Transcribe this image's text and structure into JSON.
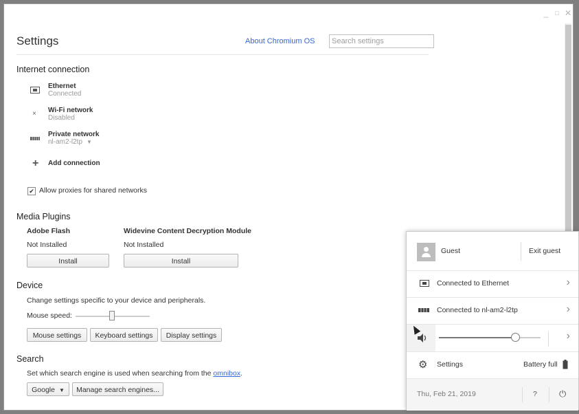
{
  "window": {
    "minimize": "_",
    "maximize": "□",
    "close": "✕"
  },
  "header": {
    "title": "Settings",
    "about_link": "About Chromium OS",
    "search_placeholder": "Search settings"
  },
  "internet": {
    "title": "Internet connection",
    "networks": [
      {
        "name": "Ethernet",
        "status": "Connected",
        "icon": "ethernet-icon"
      },
      {
        "name": "Wi-Fi network",
        "status": "Disabled",
        "icon": "wifi-off-icon"
      },
      {
        "name": "Private network",
        "status": "nl-am2-l2tp",
        "icon": "vpn-icon"
      }
    ],
    "add_connection": "Add connection",
    "proxy_label": "Allow proxies for shared networks",
    "proxy_checked": true
  },
  "media": {
    "title": "Media Plugins",
    "plugins": [
      {
        "name": "Adobe Flash",
        "status": "Not Installed",
        "button": "Install"
      },
      {
        "name": "Widevine Content Decryption Module",
        "status": "Not Installed",
        "button": "Install"
      }
    ]
  },
  "device": {
    "title": "Device",
    "description": "Change settings specific to your device and peripherals.",
    "mouse_speed_label": "Mouse speed:",
    "buttons": [
      "Mouse settings",
      "Keyboard settings",
      "Display settings"
    ]
  },
  "search": {
    "title": "Search",
    "description_prefix": "Set which search engine is used when searching from the ",
    "omnibox_link": "omnibox",
    "description_suffix": ".",
    "engine": "Google",
    "manage_button": "Manage search engines..."
  },
  "tray": {
    "user": "Guest",
    "exit_guest": "Exit guest",
    "ethernet": "Connected to Ethernet",
    "vpn": "Connected to nl-am2-l2tp",
    "volume_level": 0.75,
    "settings": "Settings",
    "battery": "Battery full",
    "date": "Thu, Feb 21, 2019",
    "help": "?",
    "power": "⏻"
  },
  "colors": {
    "link": "#3367d6",
    "tray_bg": "#ffffff",
    "backdrop": "#7f7f7f"
  }
}
